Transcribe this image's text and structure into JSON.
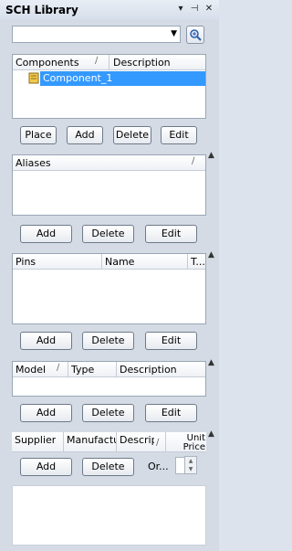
{
  "window": {
    "title": "SCH Library"
  },
  "header_icons": {
    "dropdown": "▾",
    "pin": "⊣",
    "close": "✕"
  },
  "filter": {
    "value": ""
  },
  "components": {
    "columns": [
      "Components",
      "Description"
    ],
    "rows": [
      {
        "name": "Component_1",
        "description": ""
      }
    ]
  },
  "component_buttons": [
    "Place",
    "Add",
    "Delete",
    "Edit"
  ],
  "aliases": {
    "columns": [
      "Aliases"
    ],
    "buttons": [
      "Add",
      "Delete",
      "Edit"
    ]
  },
  "pins": {
    "columns": [
      "Pins",
      "Name",
      "T..."
    ],
    "buttons": [
      "Add",
      "Delete",
      "Edit"
    ]
  },
  "models": {
    "columns": [
      "Model",
      "Type",
      "Description"
    ],
    "buttons": [
      "Add",
      "Delete",
      "Edit"
    ]
  },
  "supplier": {
    "columns": [
      "Supplier",
      "Manufactu",
      "Descrip",
      "Unit Price"
    ],
    "buttons": [
      "Add",
      "Delete"
    ],
    "order_label": "Or..."
  }
}
